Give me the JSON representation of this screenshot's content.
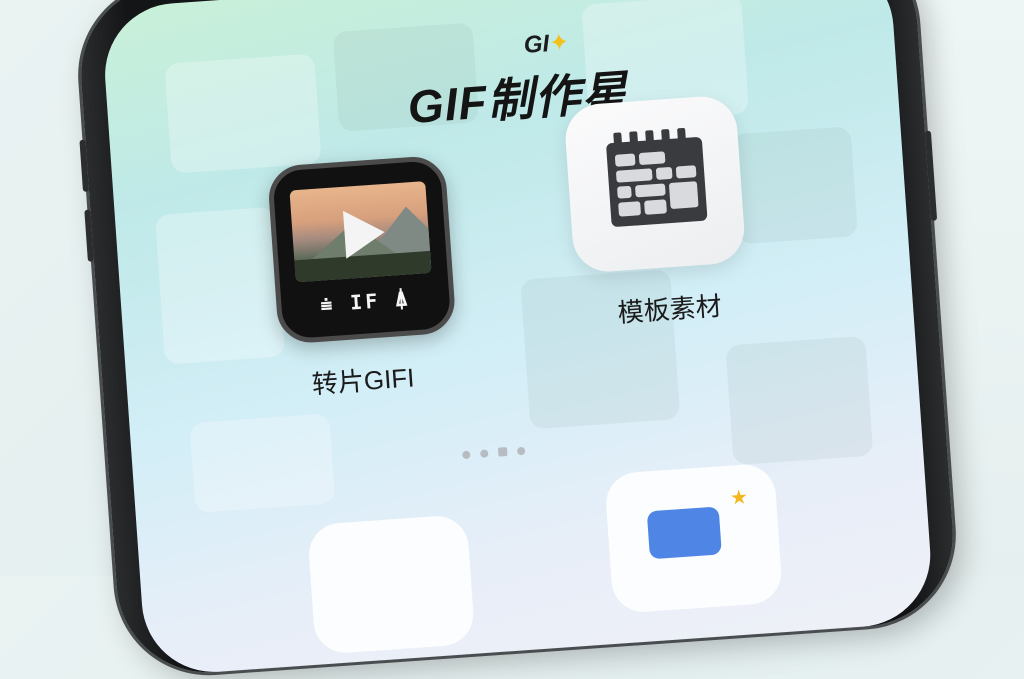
{
  "header": {
    "brand_mark": "GI",
    "brand_star": "✦",
    "title": "GIF制作星"
  },
  "apps": [
    {
      "label": "转片GIFI",
      "icon_caption": "⩧ IF ⍋"
    },
    {
      "label": "模板素材"
    }
  ],
  "colors": {
    "accent_star": "#f2c21a",
    "camera_blue": "#4f86e6",
    "phone_frame": "#141516"
  },
  "icons": [
    "video-play-icon",
    "template-grid-icon",
    "camera-icon",
    "star-icon"
  ]
}
